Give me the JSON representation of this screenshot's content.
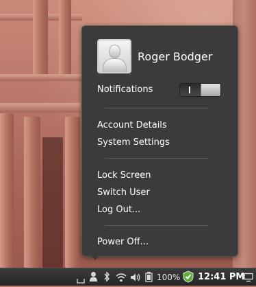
{
  "user_menu": {
    "username": "Roger Bodger",
    "notifications": {
      "label": "Notifications",
      "enabled": true
    },
    "account_items": [
      "Account Details",
      "System Settings"
    ],
    "session_items": [
      "Lock Screen",
      "Switch User",
      "Log Out..."
    ],
    "power_items": [
      "Power Off..."
    ]
  },
  "panel": {
    "battery_percent": "100%",
    "clock": "12:41 PM",
    "tray_icons": [
      "keyboard-icon",
      "user-icon",
      "bluetooth-icon",
      "wifi-icon",
      "volume-icon",
      "battery-icon",
      "shield-check-icon",
      "display-icon"
    ]
  },
  "colors": {
    "menu_bg": "#3b3b3b",
    "panel_bg": "#2e2e2e",
    "shield_green": "#5fae3a"
  }
}
